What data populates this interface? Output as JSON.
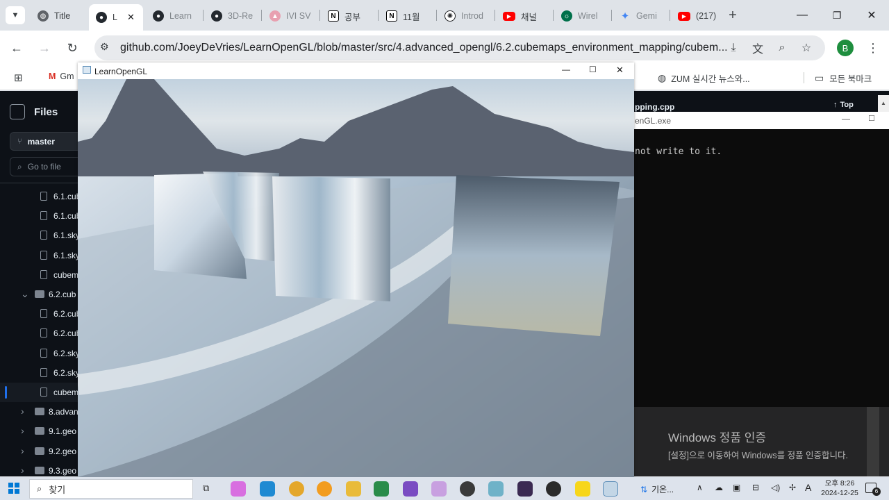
{
  "browser": {
    "tabs": [
      {
        "label": "Title",
        "favicon": "globe-icon"
      },
      {
        "label": "L",
        "favicon": "github-icon",
        "active": true
      },
      {
        "label": "Learn",
        "favicon": "github-icon"
      },
      {
        "label": "3D-Re",
        "favicon": "github-icon"
      },
      {
        "label": "IVI SV",
        "favicon": "ivi-icon"
      },
      {
        "label": "공부",
        "favicon": "notion-icon"
      },
      {
        "label": "11월",
        "favicon": "notion-icon"
      },
      {
        "label": "Introd",
        "favicon": "openai-icon"
      },
      {
        "label": "채널",
        "favicon": "youtube-icon"
      },
      {
        "label": "Wirel",
        "favicon": "starbucks-icon"
      },
      {
        "label": "Gemi",
        "favicon": "gemini-icon"
      },
      {
        "label": "(217)",
        "favicon": "youtube-icon"
      }
    ],
    "close_tab_glyph": "✕",
    "new_tab_glyph": "+",
    "url": "github.com/JoeyDeVries/LearnOpenGL/blob/master/src/4.advanced_opengl/6.2.cubemaps_environment_mapping/cubem...",
    "profile_initial": "B",
    "bookmarks": {
      "gmail": "Gm",
      "zum": "ZUM 실시간 뉴스와...",
      "all_bookmarks": "모든 북마크"
    }
  },
  "github": {
    "files_title": "Files",
    "branch": "master",
    "go_to_file": "Go to file",
    "tree": [
      {
        "label": "6.1.cub",
        "kind": "file",
        "indent": 2
      },
      {
        "label": "6.1.cub",
        "kind": "file",
        "indent": 2
      },
      {
        "label": "6.1.sky",
        "kind": "file",
        "indent": 2
      },
      {
        "label": "6.1.sky",
        "kind": "file",
        "indent": 2
      },
      {
        "label": "cubem",
        "kind": "file",
        "indent": 2
      },
      {
        "label": "6.2.cub",
        "kind": "dir-open",
        "indent": 1
      },
      {
        "label": "6.2.cub",
        "kind": "file",
        "indent": 2
      },
      {
        "label": "6.2.cub",
        "kind": "file",
        "indent": 2
      },
      {
        "label": "6.2.sky",
        "kind": "file",
        "indent": 2
      },
      {
        "label": "6.2.sky",
        "kind": "file",
        "indent": 2
      },
      {
        "label": "cubem",
        "kind": "file",
        "indent": 2,
        "selected": true
      },
      {
        "label": "8.advan",
        "kind": "dir",
        "indent": 1
      },
      {
        "label": "9.1.geo",
        "kind": "dir",
        "indent": 1
      },
      {
        "label": "9.2.geo",
        "kind": "dir",
        "indent": 1
      },
      {
        "label": "9.3.geo",
        "kind": "dir",
        "indent": 1
      }
    ],
    "file_header_fragment": "pping.cpp",
    "top_label": "Top"
  },
  "console": {
    "title_fragment": "enGL.exe",
    "text": "not write to it."
  },
  "activation": {
    "title": "Windows 정품 인증",
    "subtitle": "[설정]으로 이동하여 Windows를 정품 인증합니다."
  },
  "gl_window": {
    "title": "LearnOpenGL"
  },
  "taskbar": {
    "search_label": "찾기",
    "weather": "기온...",
    "time": "오후 8:26",
    "date": "2024-12-25",
    "notification_count": "6",
    "ime_glyph": "A"
  }
}
